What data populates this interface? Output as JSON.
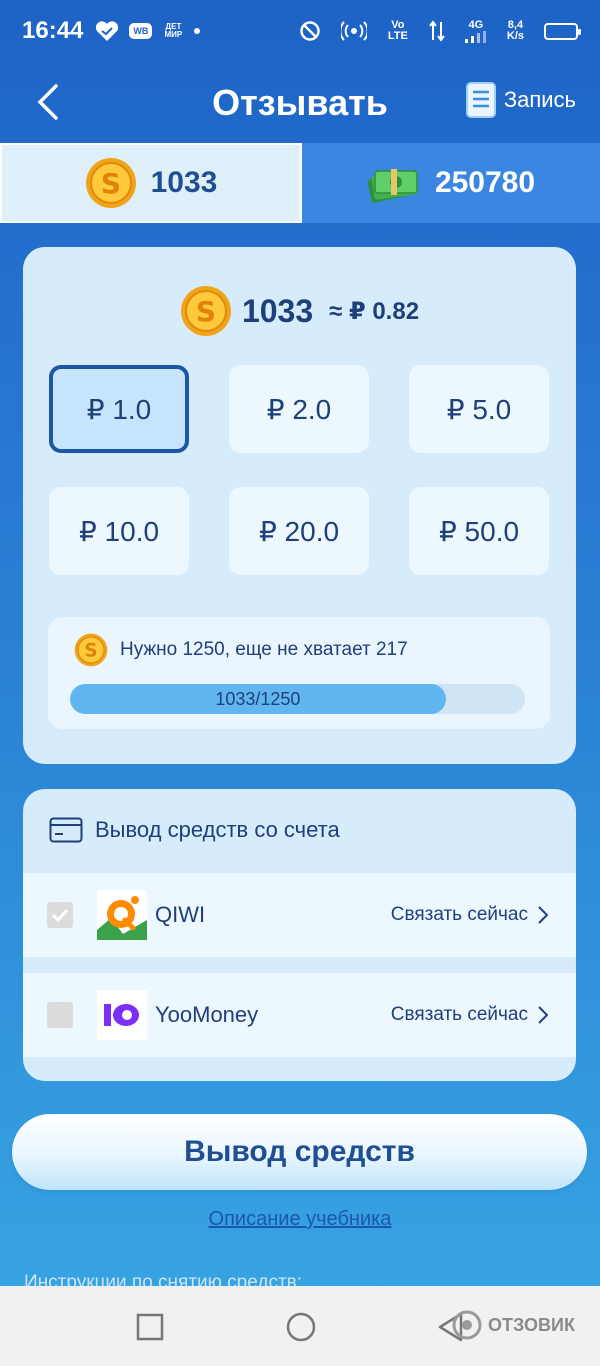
{
  "status_bar": {
    "time": "16:44",
    "icons": [
      "heart-icon",
      "wb-app-icon",
      "detmir-app-icon",
      "dot-icon",
      "do-not-disturb-icon",
      "hotspot-icon",
      "volte-icon",
      "data-arrows-icon",
      "signal-4g-icon",
      "battery-icon"
    ],
    "wb_label": "WB",
    "detmir_label": "ДЕТ МИР",
    "volte_label": "Vo LTE",
    "network_label": "4G",
    "speed_value": "8,4",
    "speed_unit": "K/s"
  },
  "header": {
    "title": "Отзывать",
    "record_label": "Запись",
    "icons": [
      "back-arrow-icon",
      "record-document-icon"
    ]
  },
  "tabs": [
    {
      "label": "1033",
      "icon": "coin-icon"
    },
    {
      "label": "250780",
      "icon": "cash-stack-icon"
    }
  ],
  "balance": {
    "coins": "1033",
    "approx": "≈ ₽ 0.82"
  },
  "amounts": [
    {
      "label": "₽ 1.0",
      "selected": true
    },
    {
      "label": "₽ 2.0",
      "selected": false
    },
    {
      "label": "₽ 5.0",
      "selected": false
    },
    {
      "label": "₽ 10.0",
      "selected": false
    },
    {
      "label": "₽ 20.0",
      "selected": false
    },
    {
      "label": "₽ 50.0",
      "selected": false
    }
  ],
  "requirement": {
    "text": "Нужно 1250, еще не хватает 217",
    "progress_label": "1033/1250",
    "progress_fraction": 0.826
  },
  "methods": {
    "title": "Вывод средств со счета",
    "items": [
      {
        "name": "QIWI",
        "link": "Связать сейчас",
        "checked": true,
        "icon": "qiwi-logo-icon"
      },
      {
        "name": "YooMoney",
        "link": "Связать сейчас",
        "checked": false,
        "icon": "yoomoney-logo-icon"
      }
    ]
  },
  "actions": {
    "withdraw_label": "Вывод средств",
    "tutorial_label": "Описание учебника",
    "instructions_label": "Инструкции по снятию средств:"
  },
  "watermark": "ОТЗОВИК",
  "colors": {
    "background_top": "#1e63c6",
    "background_bottom": "#38a7e3",
    "card": "#d6ecfa",
    "text_dark": "#1f3f7a",
    "selected_border": "#1c57a5",
    "progress": "#62b6f0"
  }
}
